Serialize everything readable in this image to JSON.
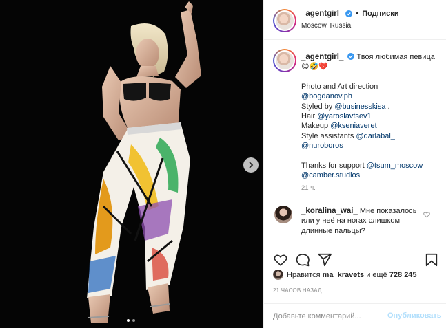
{
  "post": {
    "username": "_agentgirl_",
    "follow_separator": "•",
    "follow_label": "Подписки",
    "location": "Moscow, Russia",
    "caption": {
      "lead": "Твоя любимая певица",
      "lead_emoji": "😋🤣💔",
      "credits": [
        {
          "text": "Photo and Art direction",
          "mention": ""
        },
        {
          "text": "",
          "mention": "@bogdanov.ph"
        },
        {
          "text": "Styled by ",
          "mention": "@businesskisa",
          "tail": " ."
        },
        {
          "text": "Hair ",
          "mention": "@yaroslavtsev1"
        },
        {
          "text": "Makeup ",
          "mention": "@kseniaveret"
        },
        {
          "text": "Style assistants ",
          "mention": "@darlabal_"
        },
        {
          "text": "",
          "mention": "@nuroboros"
        }
      ],
      "thanks_text": "Thanks for support ",
      "thanks_mention_1": "@tsum_moscow",
      "thanks_mention_2": "@camber.studios"
    },
    "caption_time": "21 ч.",
    "comment": {
      "username": "_koralina_wai_",
      "text": "Мне показалось или у неё на ногах слишком длинные пальцы?"
    },
    "likes": {
      "prefix": "Нравится ",
      "user": "ma_kravets",
      "middle": " и ещё ",
      "count": "728 245"
    },
    "post_time": "21 ЧАСОВ НАЗАД",
    "add_comment_placeholder": "Добавьте комментарий...",
    "publish_label": "Опубликовать",
    "carousel": {
      "total_slides": 2,
      "active_slide": 1
    }
  },
  "colors": {
    "link": "#00376b",
    "muted": "#8e8e8e",
    "verified": "#3897f0",
    "publish_disabled": "#b2dffc",
    "heart": "#ed4956"
  }
}
